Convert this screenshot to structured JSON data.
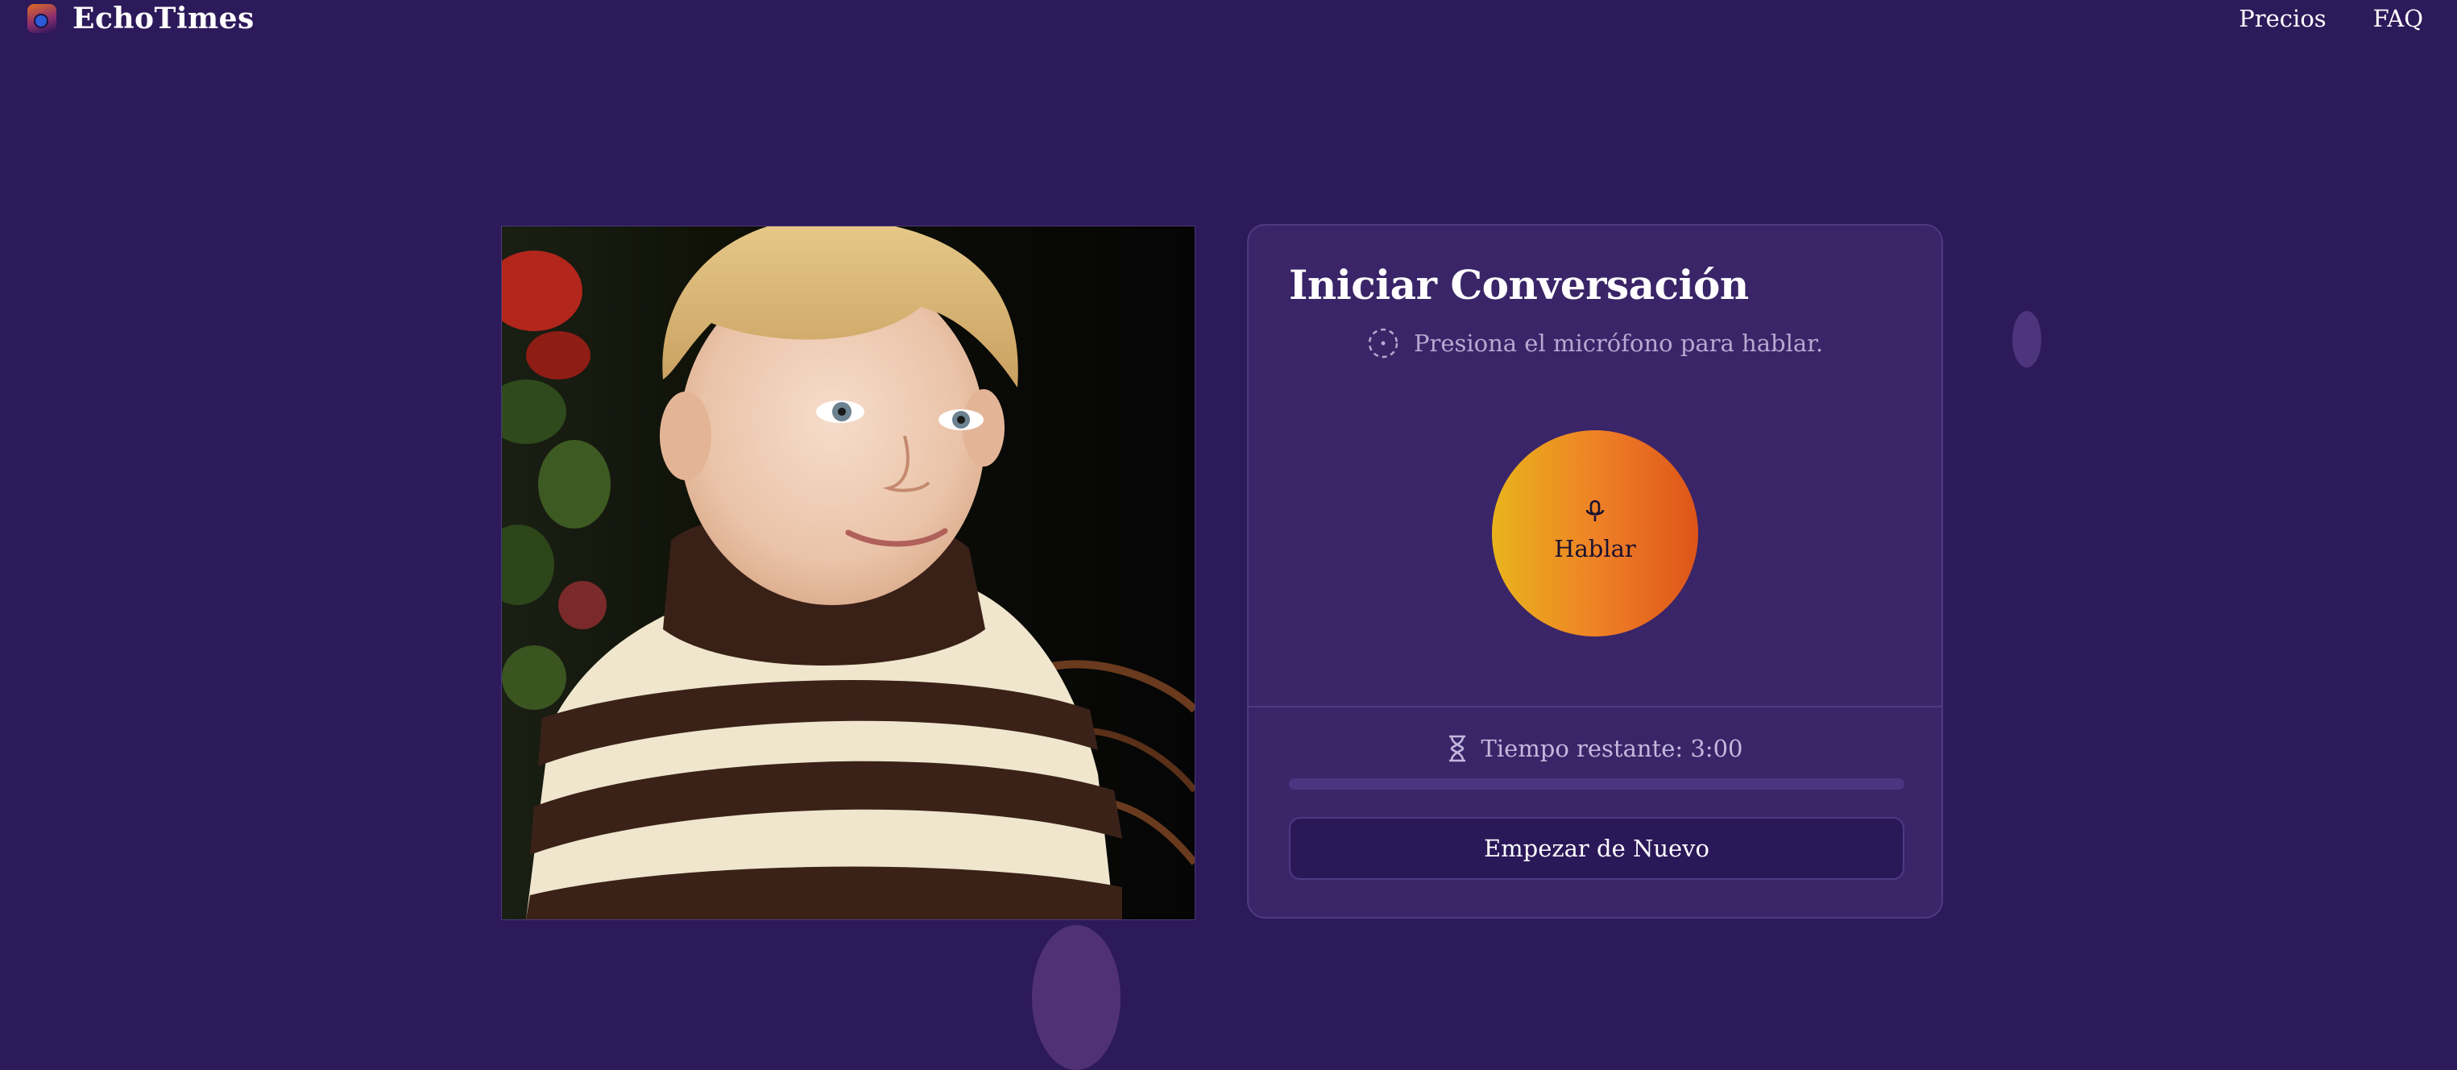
{
  "brand": {
    "name": "EchoTimes",
    "logo_icon": "echotimes-logo-icon"
  },
  "nav": {
    "items": [
      {
        "label": "Precios"
      },
      {
        "label": "FAQ"
      }
    ]
  },
  "photo": {
    "subject": "child-portrait-image"
  },
  "card": {
    "title": "Iniciar Conversación",
    "status_text": "Presiona el micrófono para hablar.",
    "status_icon": "dashed-circle-icon",
    "talk_button": {
      "label": "Hablar",
      "icon": "microphone-icon"
    },
    "timer": {
      "label": "Tiempo restante: 3:00",
      "icon": "hourglass-icon",
      "progress_fraction": 0
    },
    "restart_button": {
      "label": "Empezar de Nuevo"
    }
  },
  "colors": {
    "background": "#2d1a5a",
    "card": "#3a2568",
    "accent_gradient": [
      "#e9b41c",
      "#ee7d26",
      "#dd5518"
    ],
    "text": "#ffffff",
    "muted_text": "#b6a9d2"
  }
}
